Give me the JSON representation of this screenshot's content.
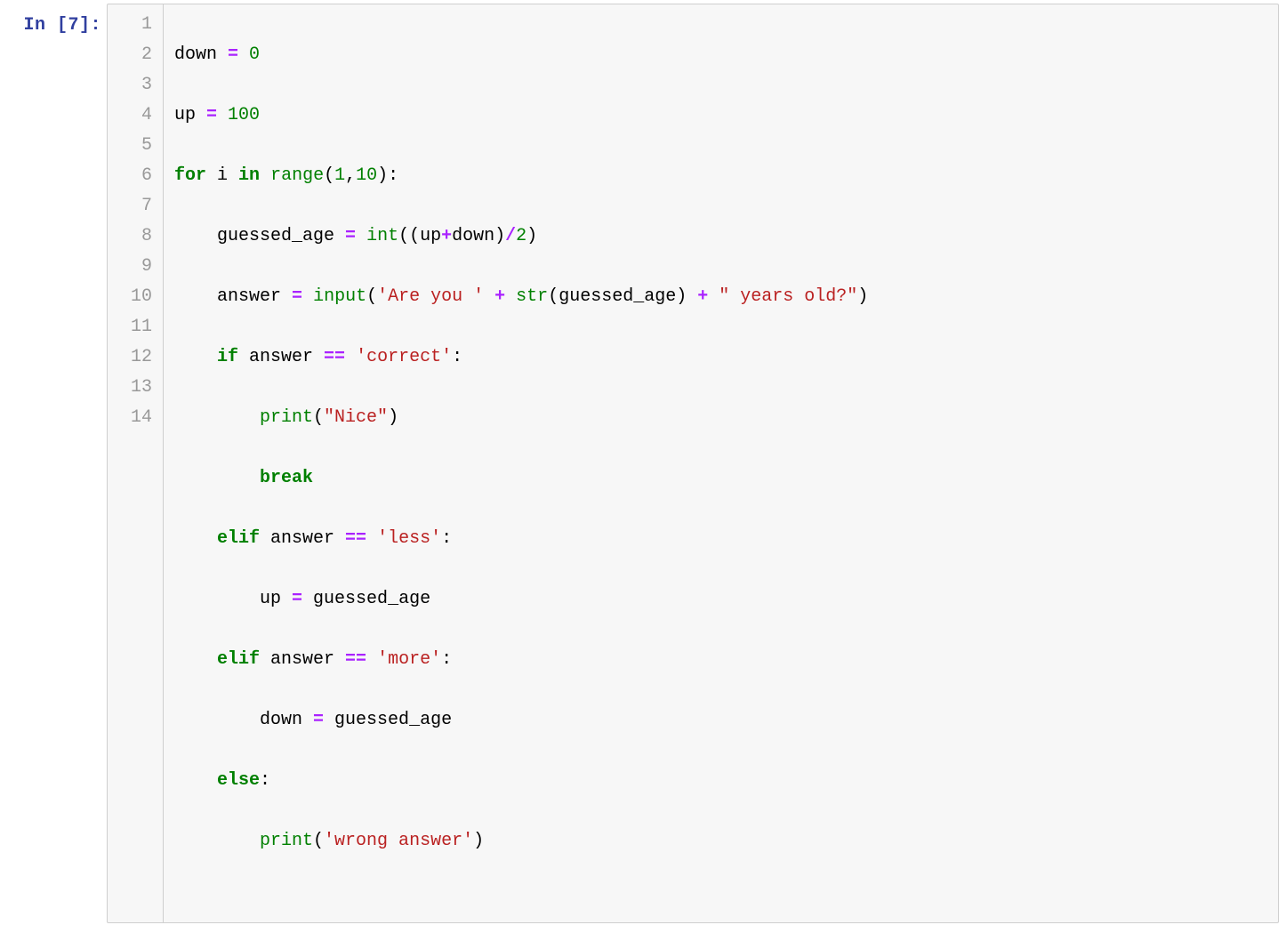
{
  "cell": {
    "prompt_prefix": "In [",
    "exec_count": "7",
    "prompt_suffix": "]:",
    "line_numbers": [
      "1",
      "2",
      "3",
      "4",
      "5",
      "6",
      "7",
      "8",
      "9",
      "10",
      "11",
      "12",
      "13",
      "14"
    ],
    "code": {
      "l1": {
        "a": "down ",
        "b": "=",
        "c": " ",
        "d": "0"
      },
      "l2": {
        "a": "up ",
        "b": "=",
        "c": " ",
        "d": "100"
      },
      "l3": {
        "a": "for",
        "b": " i ",
        "c": "in",
        "d": " ",
        "e": "range",
        "f": "(",
        "g": "1",
        "h": ",",
        "i": "10",
        "j": "):"
      },
      "l4": {
        "a": "    guessed_age ",
        "b": "=",
        "c": " ",
        "d": "int",
        "e": "((up",
        "f": "+",
        "g": "down)",
        "h": "/",
        "i": "2",
        "j": ")"
      },
      "l5": {
        "a": "    answer ",
        "b": "=",
        "c": " ",
        "d": "input",
        "e": "(",
        "f": "'Are you '",
        "g": " ",
        "h": "+",
        "i": " ",
        "j": "str",
        "k": "(guessed_age) ",
        "l": "+",
        "m": " ",
        "n": "\" years old?\"",
        "o": ")"
      },
      "l6": {
        "a": "    ",
        "b": "if",
        "c": " answer ",
        "d": "==",
        "e": " ",
        "f": "'correct'",
        "g": ":"
      },
      "l7": {
        "a": "        ",
        "b": "print",
        "c": "(",
        "d": "\"Nice\"",
        "e": ")"
      },
      "l8": {
        "a": "        ",
        "b": "break"
      },
      "l9": {
        "a": "    ",
        "b": "elif",
        "c": " answer ",
        "d": "==",
        "e": " ",
        "f": "'less'",
        "g": ":"
      },
      "l10": {
        "a": "        up ",
        "b": "=",
        "c": " guessed_age"
      },
      "l11": {
        "a": "    ",
        "b": "elif",
        "c": " answer ",
        "d": "==",
        "e": " ",
        "f": "'more'",
        "g": ":"
      },
      "l12": {
        "a": "        down ",
        "b": "=",
        "c": " guessed_age"
      },
      "l13": {
        "a": "    ",
        "b": "else",
        "c": ":"
      },
      "l14": {
        "a": "        ",
        "b": "print",
        "c": "(",
        "d": "'wrong answer'",
        "e": ")"
      }
    }
  }
}
